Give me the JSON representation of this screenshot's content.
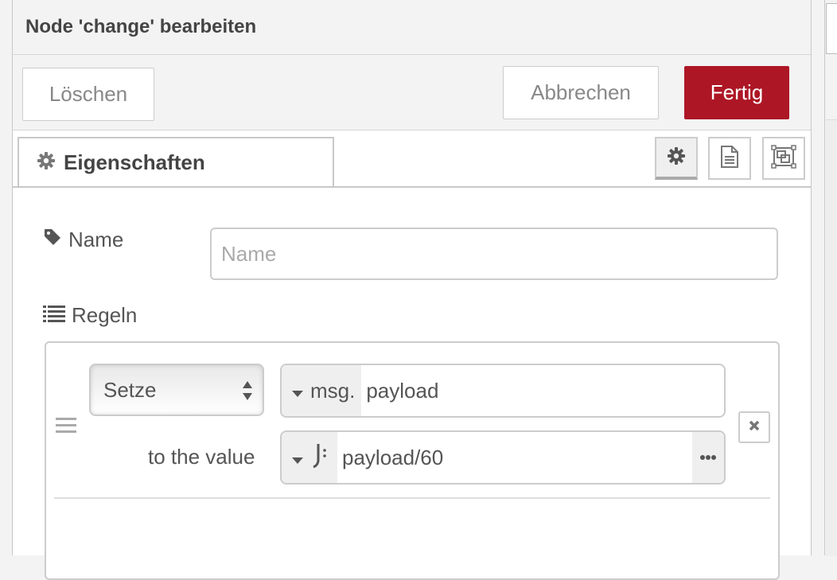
{
  "header": {
    "title": "Node 'change' bearbeiten"
  },
  "toolbar": {
    "delete_label": "Löschen",
    "cancel_label": "Abbrechen",
    "done_label": "Fertig"
  },
  "colors": {
    "primary": "#ad1625",
    "border": "#cccccc",
    "text": "#555555"
  },
  "tabs": {
    "active_label": "Eigenschaften",
    "icons": [
      "gear-icon",
      "description-icon",
      "appearance-icon"
    ]
  },
  "form": {
    "name_label": "Name",
    "name_placeholder": "Name",
    "name_value": "",
    "rules_label": "Regeln",
    "rules": [
      {
        "action": "Setze",
        "target_type": "msg.",
        "target_value": "payload",
        "value_label": "to the value",
        "value_type_icon": "J:",
        "value": "payload/60"
      }
    ]
  }
}
